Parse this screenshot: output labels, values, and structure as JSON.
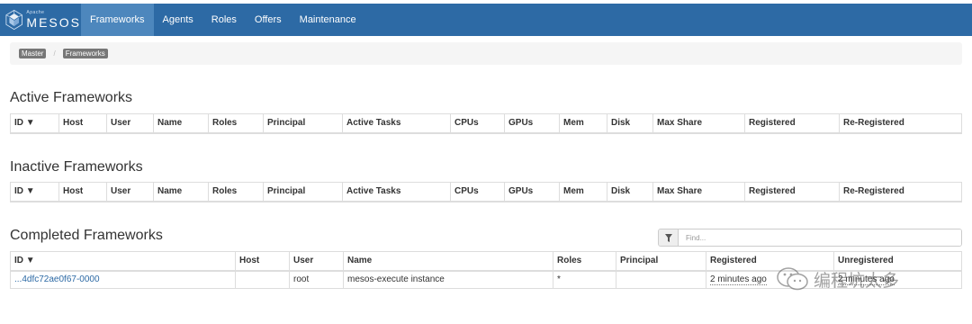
{
  "navbar": {
    "brand_small": "Apache",
    "brand_name": "MESOS",
    "items": [
      {
        "label": "Frameworks",
        "active": true
      },
      {
        "label": "Agents",
        "active": false
      },
      {
        "label": "Roles",
        "active": false
      },
      {
        "label": "Offers",
        "active": false
      },
      {
        "label": "Maintenance",
        "active": false
      }
    ]
  },
  "breadcrumb": {
    "master": "Master",
    "frameworks": "Frameworks",
    "separator": "/"
  },
  "active": {
    "title": "Active Frameworks",
    "columns": [
      "ID ▼",
      "Host",
      "User",
      "Name",
      "Roles",
      "Principal",
      "Active Tasks",
      "CPUs",
      "GPUs",
      "Mem",
      "Disk",
      "Max Share",
      "Registered",
      "Re-Registered"
    ]
  },
  "inactive": {
    "title": "Inactive Frameworks",
    "columns": [
      "ID ▼",
      "Host",
      "User",
      "Name",
      "Roles",
      "Principal",
      "Active Tasks",
      "CPUs",
      "GPUs",
      "Mem",
      "Disk",
      "Max Share",
      "Registered",
      "Re-Registered"
    ]
  },
  "completed": {
    "title": "Completed Frameworks",
    "filter_placeholder": "Find...",
    "columns": [
      "ID ▼",
      "Host",
      "User",
      "Name",
      "Roles",
      "Principal",
      "Registered",
      "Unregistered"
    ],
    "rows": [
      {
        "id": "...4dfc72ae0f67-0000",
        "host": "",
        "user": "root",
        "name": "mesos-execute instance",
        "roles": "*",
        "principal": "",
        "registered": "2 minutes ago",
        "unregistered": "2 minutes ago"
      }
    ]
  },
  "watermark": {
    "text": "编程坑太多"
  },
  "colors": {
    "navbar": "#2d6aa5",
    "nav_active": "#4d87bd",
    "link": "#2d6aa5"
  }
}
